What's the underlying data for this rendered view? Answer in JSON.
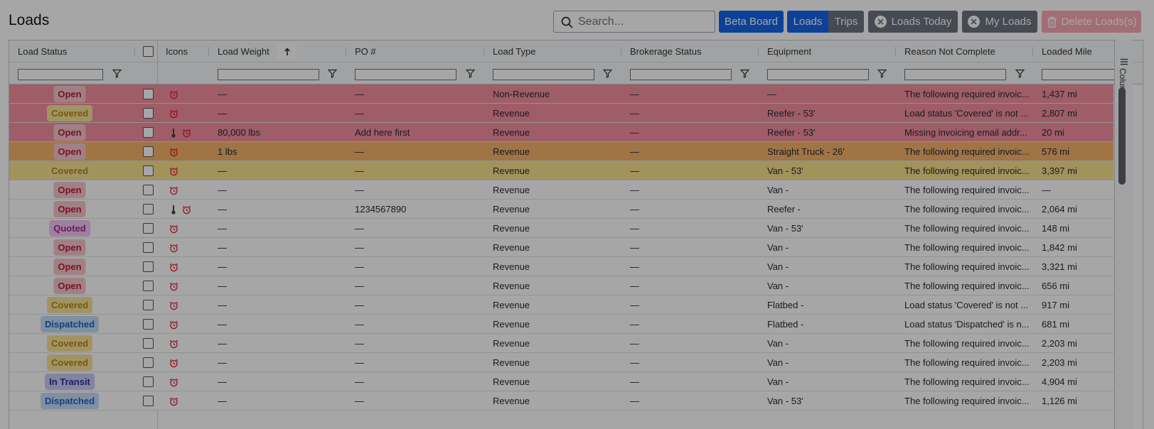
{
  "header": {
    "title": "Loads",
    "search_placeholder": "Search...",
    "beta_board": "Beta Board",
    "loads_tab": "Loads",
    "trips_tab": "Trips",
    "loads_today": "Loads Today",
    "my_loads": "My Loads",
    "delete_loads": "Delete Loads(s)"
  },
  "columns": {
    "load_status": "Load Status",
    "icons": "Icons",
    "load_weight": "Load Weight",
    "po": "PO #",
    "load_type": "Load Type",
    "brokerage_status": "Brokerage Status",
    "equipment": "Equipment",
    "reason": "Reason Not Complete",
    "loaded_miles": "Loaded Mile"
  },
  "side_panel": {
    "columns_label": "Columns"
  },
  "status_colors": {
    "Open": {
      "bg": "#f5c6cc",
      "fg": "#c0193a"
    },
    "Covered": {
      "bg": "#f7e39a",
      "fg": "#b8860b"
    },
    "Quoted": {
      "bg": "#f3c6f1",
      "fg": "#a0289c"
    },
    "Dispatched": {
      "bg": "#c5dcf7",
      "fg": "#1a64c8"
    },
    "In Transit": {
      "bg": "#c9cdf4",
      "fg": "#2a2f9e"
    }
  },
  "rows": [
    {
      "status": "Open",
      "thermo": false,
      "weight": "—",
      "po": "—",
      "type": "Non-Revenue",
      "brokerage": "—",
      "equipment": "—",
      "reason": "The following required invoic...",
      "miles": "1,437 mi",
      "bg": "#f58f9f"
    },
    {
      "status": "Covered",
      "thermo": false,
      "weight": "—",
      "po": "—",
      "type": "Revenue",
      "brokerage": "—",
      "equipment": "Reefer - 53'",
      "reason": "Load status 'Covered' is not ...",
      "miles": "2,807 mi",
      "bg": "#f58f9f"
    },
    {
      "status": "Open",
      "thermo": true,
      "weight": "80,000 lbs",
      "po": "Add here first",
      "type": "Revenue",
      "brokerage": "—",
      "equipment": "Reefer - 53'",
      "reason": "Missing invoicing email addr...",
      "miles": "20 mi",
      "bg": "#f58f9f"
    },
    {
      "status": "Open",
      "thermo": false,
      "weight": "1 lbs",
      "po": "—",
      "type": "Revenue",
      "brokerage": "—",
      "equipment": "Straight Truck - 26'",
      "reason": "The following required invoic...",
      "miles": "576 mi",
      "bg": "#f6b26b"
    },
    {
      "status": "Covered",
      "thermo": false,
      "weight": "—",
      "po": "—",
      "type": "Revenue",
      "brokerage": "—",
      "equipment": "Van - 53'",
      "reason": "The following required invoic...",
      "miles": "3,397 mi",
      "bg": "#f9e08c"
    },
    {
      "status": "Open",
      "thermo": false,
      "weight": "—",
      "po": "—",
      "type": "Revenue",
      "brokerage": "—",
      "equipment": "Van -",
      "reason": "The following required invoic...",
      "miles": "—",
      "bg": "#ffffff"
    },
    {
      "status": "Open",
      "thermo": true,
      "weight": "—",
      "po": "1234567890",
      "type": "Revenue",
      "brokerage": "—",
      "equipment": "Reefer -",
      "reason": "The following required invoic...",
      "miles": "2,064 mi",
      "bg": "#ffffff"
    },
    {
      "status": "Quoted",
      "thermo": false,
      "weight": "—",
      "po": "—",
      "type": "Revenue",
      "brokerage": "—",
      "equipment": "Van - 53'",
      "reason": "The following required invoic...",
      "miles": "148 mi",
      "bg": "#ffffff"
    },
    {
      "status": "Open",
      "thermo": false,
      "weight": "—",
      "po": "—",
      "type": "Revenue",
      "brokerage": "—",
      "equipment": "Van -",
      "reason": "The following required invoic...",
      "miles": "1,842 mi",
      "bg": "#ffffff"
    },
    {
      "status": "Open",
      "thermo": false,
      "weight": "—",
      "po": "—",
      "type": "Revenue",
      "brokerage": "—",
      "equipment": "Van -",
      "reason": "The following required invoic...",
      "miles": "3,321 mi",
      "bg": "#ffffff"
    },
    {
      "status": "Open",
      "thermo": false,
      "weight": "—",
      "po": "—",
      "type": "Revenue",
      "brokerage": "—",
      "equipment": "Van -",
      "reason": "The following required invoic...",
      "miles": "656 mi",
      "bg": "#ffffff"
    },
    {
      "status": "Covered",
      "thermo": false,
      "weight": "—",
      "po": "—",
      "type": "Revenue",
      "brokerage": "—",
      "equipment": "Flatbed -",
      "reason": "Load status 'Covered' is not ...",
      "miles": "917 mi",
      "bg": "#ffffff"
    },
    {
      "status": "Dispatched",
      "thermo": false,
      "weight": "—",
      "po": "—",
      "type": "Revenue",
      "brokerage": "—",
      "equipment": "Flatbed -",
      "reason": "Load status 'Dispatched' is n...",
      "miles": "681 mi",
      "bg": "#ffffff"
    },
    {
      "status": "Covered",
      "thermo": false,
      "weight": "—",
      "po": "—",
      "type": "Revenue",
      "brokerage": "—",
      "equipment": "Van -",
      "reason": "The following required invoic...",
      "miles": "2,203 mi",
      "bg": "#ffffff"
    },
    {
      "status": "Covered",
      "thermo": false,
      "weight": "—",
      "po": "—",
      "type": "Revenue",
      "brokerage": "—",
      "equipment": "Van -",
      "reason": "The following required invoic...",
      "miles": "2,203 mi",
      "bg": "#ffffff"
    },
    {
      "status": "In Transit",
      "thermo": false,
      "weight": "—",
      "po": "—",
      "type": "Revenue",
      "brokerage": "—",
      "equipment": "Van -",
      "reason": "The following required invoic...",
      "miles": "4,904 mi",
      "bg": "#ffffff"
    },
    {
      "status": "Dispatched",
      "thermo": false,
      "weight": "—",
      "po": "—",
      "type": "Revenue",
      "brokerage": "—",
      "equipment": "Van - 53'",
      "reason": "The following required invoic...",
      "miles": "1,126 mi",
      "bg": "#ffffff"
    }
  ]
}
